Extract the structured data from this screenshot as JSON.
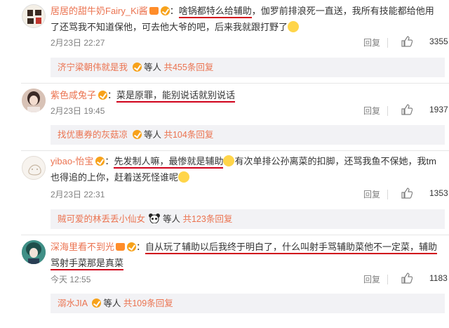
{
  "comments": [
    {
      "username": "居居的甜牛奶Fairy_Ki酱",
      "text_highlight": "啥锅都特么给辅助",
      "text_rest": "，伽罗前排浪死一直送，我所有技能都给他用了还骂我不知道保他，可去他大爷的吧，后来我就跟打野了",
      "date": "2月23日 22:27",
      "reply_label": "回复",
      "likes": "3355",
      "reply_user": "济宁梁朝伟就是我",
      "reply_mid": "等人",
      "reply_count": "共455条回复"
    },
    {
      "username": "紫色咸兔子",
      "text_highlight": "菜是原罪，能别说话就别说话",
      "text_rest": "",
      "date": "2月23日 19:45",
      "reply_label": "回复",
      "likes": "1937",
      "reply_user": "找优惠券的灰菇凉",
      "reply_mid": "等人",
      "reply_count": "共104条回复"
    },
    {
      "username": "yibao-怡宝",
      "text_highlight": "先发制人嘛，最惨就是辅助",
      "text_rest": "有次单排公孙离菜的扣脚，还骂我鱼不保她，我tm也得追的上你，赶着送死怪谁呢",
      "date": "2月23日 22:31",
      "reply_label": "回复",
      "likes": "1353",
      "reply_user": "贼可爱的林丢丢小仙女",
      "reply_mid": "等人",
      "reply_count": "共123条回复"
    },
    {
      "username": "深海里看不到光",
      "text_highlight": "自从玩了辅助以后我终于明白了，什么叫射手骂辅助菜他不一定菜，辅助",
      "text_highlight2": "骂射手菜那是真菜",
      "date": "今天 12:55",
      "reply_label": "回复",
      "likes": "1183",
      "reply_user": "溺水JIA",
      "reply_mid": "等人",
      "reply_count": "共109条回复"
    }
  ],
  "colors": {
    "username": "#eb7350",
    "highlight_underline": "#d0021b",
    "reply_bg": "#f2f2f5"
  }
}
